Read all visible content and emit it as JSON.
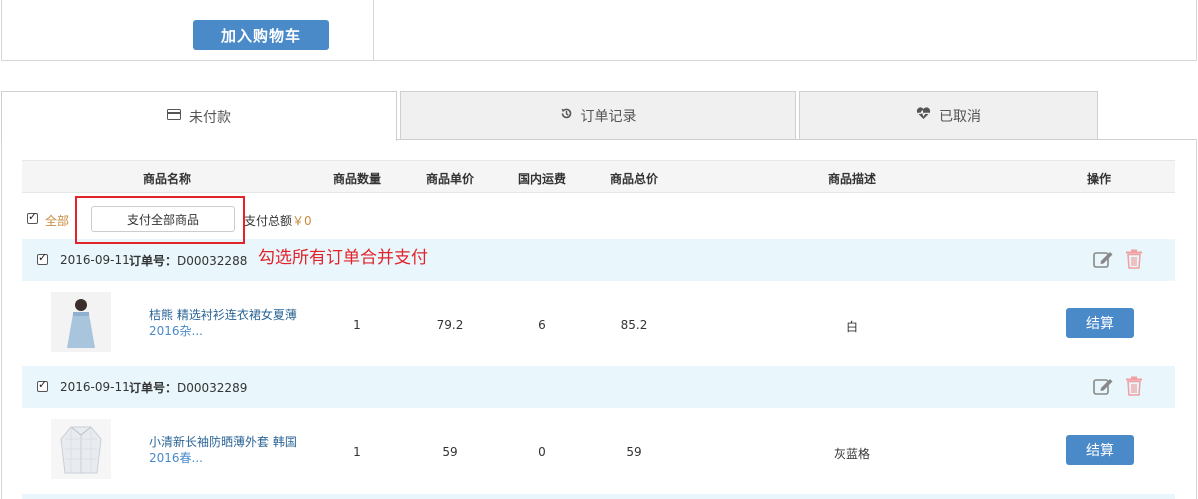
{
  "top": {
    "cart_button": "加入购物车"
  },
  "tabs": [
    {
      "label": "未付款",
      "icon": "credit-card-icon",
      "active": true
    },
    {
      "label": "订单记录",
      "icon": "history-icon",
      "active": false
    },
    {
      "label": "已取消",
      "icon": "heartbeat-icon",
      "active": false
    }
  ],
  "columns": [
    "商品名称",
    "商品数量",
    "商品单价",
    "国内运费",
    "商品总价",
    "商品描述",
    "操作"
  ],
  "select_row": {
    "all_label": "全部",
    "pay_all_button": "支付全部商品",
    "pay_total_label": "支付总额",
    "pay_total_value": "￥0"
  },
  "annotation": "勾选所有订单合并支付",
  "order_label": "订单号：",
  "orders": [
    {
      "date": "2016-09-11",
      "order_no": "D00032288",
      "product_name": "桔熊 精选衬衫连衣裙女夏薄",
      "product_name_more": "2016杂...",
      "quantity": "1",
      "unit_price": "79.2",
      "shipping": "6",
      "total": "85.2",
      "description": "白",
      "action": "结算"
    },
    {
      "date": "2016-09-11",
      "order_no": "D00032289",
      "product_name": "小清新长袖防晒薄外套 韩国",
      "product_name_more": "2016春...",
      "quantity": "1",
      "unit_price": "59",
      "shipping": "0",
      "total": "59",
      "description": "灰蓝格",
      "action": "结算"
    }
  ],
  "colors": {
    "accent": "#4a8ac9",
    "order_head_bg": "#e9f6fc",
    "annotation": "#e0242a",
    "price_orange": "#c78b3f"
  }
}
